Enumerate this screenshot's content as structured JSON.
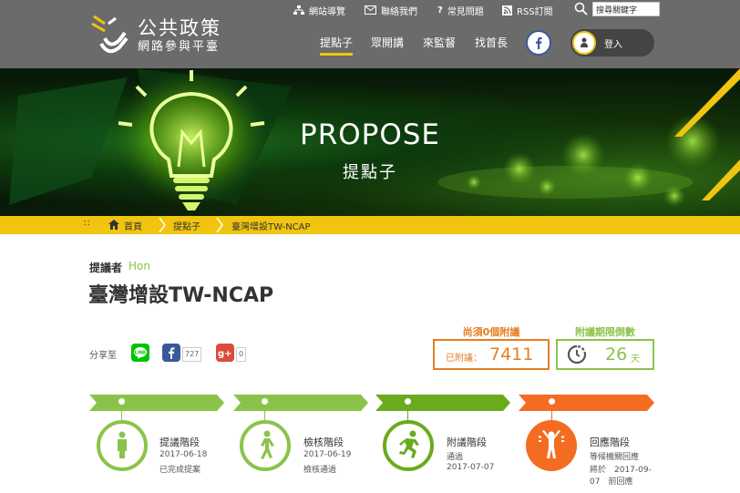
{
  "site": {
    "logo_line1": "公共政策",
    "logo_line2": "網路參與平臺"
  },
  "utility_nav": [
    {
      "label": "網站導覽",
      "icon": "sitemap-icon"
    },
    {
      "label": "聯絡我們",
      "icon": "mail-icon"
    },
    {
      "label": "常見問題",
      "icon": "question-icon"
    },
    {
      "label": "RSS訂閱",
      "icon": "rss-icon"
    }
  ],
  "search": {
    "value": "搜尋關鍵字"
  },
  "main_nav": [
    {
      "label": "提點子",
      "active": true
    },
    {
      "label": "眾開講",
      "active": false
    },
    {
      "label": "來監督",
      "active": false
    },
    {
      "label": "找首長",
      "active": false
    }
  ],
  "login": {
    "label": "登入"
  },
  "banner": {
    "title": "PROPOSE",
    "subtitle": "提點子"
  },
  "breadcrumb": [
    "首頁",
    "提點子",
    "臺灣增設TW-NCAP"
  ],
  "proposal": {
    "proposer_label": "提議者",
    "proposer_name": "Hon",
    "title": "臺灣增設TW-NCAP"
  },
  "share": {
    "label": "分享至",
    "facebook_count": "727",
    "gplus_count": "0"
  },
  "stats": {
    "needed_label": "尚須0個附議",
    "attached_label": "已附議：",
    "attached_value": "7411",
    "deadline_label": "附議期限倒數",
    "days_value": "26",
    "days_unit": "天"
  },
  "stages": [
    {
      "name": "提議階段",
      "line1": "2017-06-18",
      "line2": "已完成提案",
      "color": "#8bc34a"
    },
    {
      "name": "檢核階段",
      "line1": "2017-06-19",
      "line2": "檢核通過",
      "color": "#8bc34a"
    },
    {
      "name": "附議階段",
      "line1": "通過",
      "line2": "2017-07-07",
      "color": "#6aab1e"
    },
    {
      "name": "回應階段",
      "line1": "等候機關回應",
      "line2": "將於　2017-09-",
      "line3": "07　前回應",
      "color": "#f36c21"
    }
  ],
  "colors": {
    "accent_yellow": "#f1c40f",
    "green": "#8bc34a",
    "orange": "#e67e22",
    "header_gray": "#6b6b6b"
  }
}
